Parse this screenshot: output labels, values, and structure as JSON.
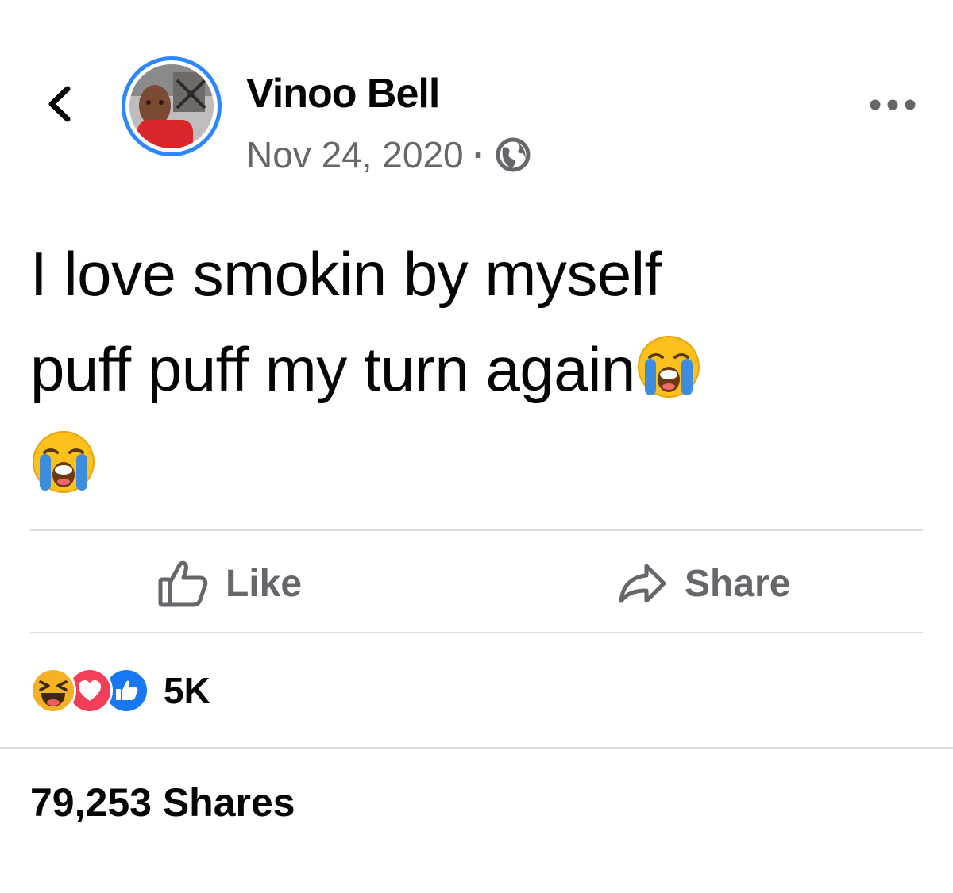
{
  "post": {
    "author": "Vinoo Bell",
    "date": "Nov 24, 2020",
    "separator": "·",
    "privacy_icon": "globe-icon",
    "text_line1": "I love smokin by myself",
    "text_line2": "puff puff my turn again",
    "emoji_icon": "loudly-crying-face-emoji"
  },
  "actions": {
    "like_label": "Like",
    "share_label": "Share"
  },
  "engagement": {
    "reaction_icons": [
      "haha-reaction-icon",
      "love-reaction-icon",
      "like-reaction-icon"
    ],
    "reaction_count": "5K",
    "shares_text": "79,253 Shares"
  },
  "colors": {
    "accent": "#2d88ff",
    "secondary_text": "#65676b",
    "divider": "#dadde1",
    "love": "#f33e58",
    "like": "#1877f2",
    "haha": "#f7b125"
  }
}
